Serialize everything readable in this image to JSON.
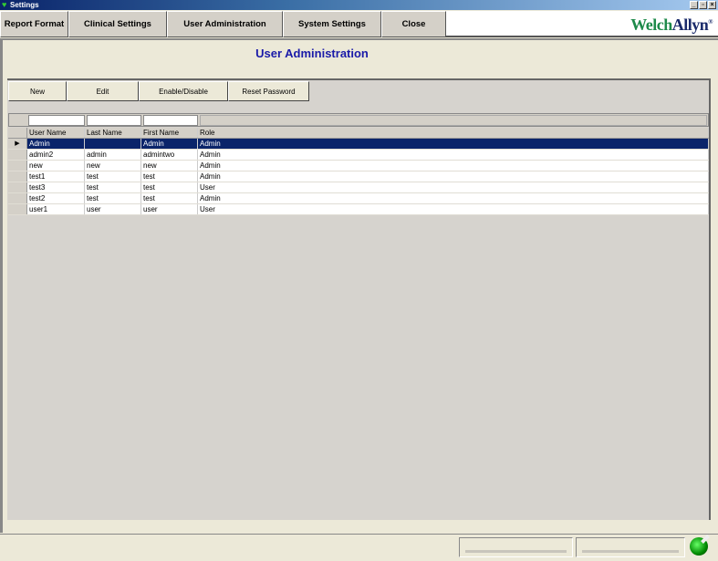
{
  "window": {
    "title": "Settings",
    "minimize": "_",
    "restore": "▫",
    "close": "×"
  },
  "tabs": [
    "Report Format",
    "Clinical Settings",
    "User Administration",
    "System Settings",
    "Close"
  ],
  "logo": {
    "part1": "Welch",
    "part2": "Allyn",
    "mark": "®"
  },
  "page_title": "User Administration",
  "toolbar": {
    "new": "New",
    "edit": "Edit",
    "enable_disable": "Enable/Disable",
    "reset_password": "Reset Password"
  },
  "grid": {
    "columns": [
      "User Name",
      "Last Name",
      "First Name",
      "Role"
    ],
    "rows": [
      [
        "Admin",
        "",
        "Admin",
        "Admin"
      ],
      [
        "admin2",
        "admin",
        "admintwo",
        "Admin"
      ],
      [
        "new",
        "new",
        "new",
        "Admin"
      ],
      [
        "test1",
        "test",
        "test",
        "Admin"
      ],
      [
        "test3",
        "test",
        "test",
        "User"
      ],
      [
        "test2",
        "test",
        "test",
        "Admin"
      ],
      [
        "user1",
        "user",
        "user",
        "User"
      ]
    ],
    "selected_row": 0,
    "current_row_marker": "▶"
  },
  "colors": {
    "accent": "#1a1aa8",
    "selection": "#0a246a"
  }
}
